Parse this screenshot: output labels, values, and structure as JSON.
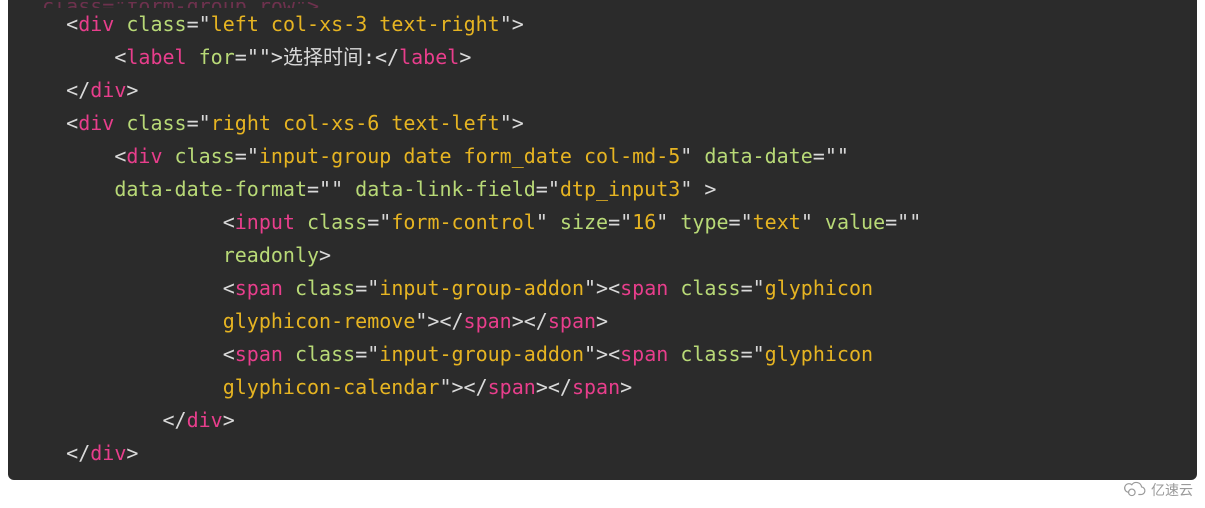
{
  "code": {
    "line0_frag": "  class=\"form-group row\">",
    "lines": [
      {
        "indent": 1,
        "parts": [
          {
            "c": "t-punct",
            "t": "<"
          },
          {
            "c": "t-tag",
            "t": "div"
          },
          {
            "c": "t-punct",
            "t": " "
          },
          {
            "c": "t-attr",
            "t": "class"
          },
          {
            "c": "t-op",
            "t": "="
          },
          {
            "c": "t-punct",
            "t": "\""
          },
          {
            "c": "t-str",
            "t": "left col-xs-3 text-right"
          },
          {
            "c": "t-punct",
            "t": "\""
          },
          {
            "c": "t-punct",
            "t": ">"
          }
        ]
      },
      {
        "indent": 2,
        "parts": [
          {
            "c": "t-punct",
            "t": "<"
          },
          {
            "c": "t-tag",
            "t": "label"
          },
          {
            "c": "t-punct",
            "t": " "
          },
          {
            "c": "t-attr",
            "t": "for"
          },
          {
            "c": "t-op",
            "t": "="
          },
          {
            "c": "t-punct",
            "t": "\""
          },
          {
            "c": "t-str",
            "t": ""
          },
          {
            "c": "t-punct",
            "t": "\""
          },
          {
            "c": "t-punct",
            "t": ">"
          },
          {
            "c": "t-text",
            "t": "选择时间:"
          },
          {
            "c": "t-punct",
            "t": "</"
          },
          {
            "c": "t-tag",
            "t": "label"
          },
          {
            "c": "t-punct",
            "t": ">"
          }
        ]
      },
      {
        "indent": 1,
        "parts": [
          {
            "c": "t-punct",
            "t": "</"
          },
          {
            "c": "t-tag",
            "t": "div"
          },
          {
            "c": "t-punct",
            "t": ">"
          }
        ]
      },
      {
        "indent": 1,
        "parts": [
          {
            "c": "t-punct",
            "t": "<"
          },
          {
            "c": "t-tag",
            "t": "div"
          },
          {
            "c": "t-punct",
            "t": " "
          },
          {
            "c": "t-attr",
            "t": "class"
          },
          {
            "c": "t-op",
            "t": "="
          },
          {
            "c": "t-punct",
            "t": "\""
          },
          {
            "c": "t-str",
            "t": "right col-xs-6 text-left"
          },
          {
            "c": "t-punct",
            "t": "\""
          },
          {
            "c": "t-punct",
            "t": ">"
          }
        ]
      },
      {
        "indent": 2,
        "parts": [
          {
            "c": "t-punct",
            "t": "<"
          },
          {
            "c": "t-tag",
            "t": "div"
          },
          {
            "c": "t-punct",
            "t": " "
          },
          {
            "c": "t-attr",
            "t": "class"
          },
          {
            "c": "t-op",
            "t": "="
          },
          {
            "c": "t-punct",
            "t": "\""
          },
          {
            "c": "t-str",
            "t": "input-group date form_date col-md-5"
          },
          {
            "c": "t-punct",
            "t": "\""
          },
          {
            "c": "t-punct",
            "t": " "
          },
          {
            "c": "t-attr",
            "t": "data-date"
          },
          {
            "c": "t-op",
            "t": "="
          },
          {
            "c": "t-punct",
            "t": "\""
          },
          {
            "c": "t-str",
            "t": ""
          },
          {
            "c": "t-punct",
            "t": "\""
          }
        ]
      },
      {
        "indent": 2,
        "parts": [
          {
            "c": "t-attr",
            "t": "data-date-format"
          },
          {
            "c": "t-op",
            "t": "="
          },
          {
            "c": "t-punct",
            "t": "\""
          },
          {
            "c": "t-str",
            "t": ""
          },
          {
            "c": "t-punct",
            "t": "\""
          },
          {
            "c": "t-punct",
            "t": " "
          },
          {
            "c": "t-attr",
            "t": "data-link-field"
          },
          {
            "c": "t-op",
            "t": "="
          },
          {
            "c": "t-punct",
            "t": "\""
          },
          {
            "c": "t-str",
            "t": "dtp_input3"
          },
          {
            "c": "t-punct",
            "t": "\""
          },
          {
            "c": "t-punct",
            "t": " >"
          }
        ]
      },
      {
        "indent": 4,
        "parts": [
          {
            "c": "t-punct",
            "t": "<"
          },
          {
            "c": "t-tag",
            "t": "input"
          },
          {
            "c": "t-punct",
            "t": " "
          },
          {
            "c": "t-attr",
            "t": "class"
          },
          {
            "c": "t-op",
            "t": "="
          },
          {
            "c": "t-punct",
            "t": "\""
          },
          {
            "c": "t-str",
            "t": "form-control"
          },
          {
            "c": "t-punct",
            "t": "\""
          },
          {
            "c": "t-punct",
            "t": " "
          },
          {
            "c": "t-attr",
            "t": "size"
          },
          {
            "c": "t-op",
            "t": "="
          },
          {
            "c": "t-punct",
            "t": "\""
          },
          {
            "c": "t-str",
            "t": "16"
          },
          {
            "c": "t-punct",
            "t": "\""
          },
          {
            "c": "t-punct",
            "t": " "
          },
          {
            "c": "t-attr",
            "t": "type"
          },
          {
            "c": "t-op",
            "t": "="
          },
          {
            "c": "t-punct",
            "t": "\""
          },
          {
            "c": "t-str",
            "t": "text"
          },
          {
            "c": "t-punct",
            "t": "\""
          },
          {
            "c": "t-punct",
            "t": " "
          },
          {
            "c": "t-attr",
            "t": "value"
          },
          {
            "c": "t-op",
            "t": "="
          },
          {
            "c": "t-punct",
            "t": "\""
          },
          {
            "c": "t-str",
            "t": ""
          },
          {
            "c": "t-punct",
            "t": "\""
          }
        ]
      },
      {
        "indent": 4,
        "parts": [
          {
            "c": "t-attr",
            "t": "readonly"
          },
          {
            "c": "t-punct",
            "t": ">"
          }
        ]
      },
      {
        "indent": 4,
        "parts": [
          {
            "c": "t-punct",
            "t": "<"
          },
          {
            "c": "t-tag",
            "t": "span"
          },
          {
            "c": "t-punct",
            "t": " "
          },
          {
            "c": "t-attr",
            "t": "class"
          },
          {
            "c": "t-op",
            "t": "="
          },
          {
            "c": "t-punct",
            "t": "\""
          },
          {
            "c": "t-str",
            "t": "input-group-addon"
          },
          {
            "c": "t-punct",
            "t": "\""
          },
          {
            "c": "t-punct",
            "t": ">"
          },
          {
            "c": "t-punct",
            "t": "<"
          },
          {
            "c": "t-tag",
            "t": "span"
          },
          {
            "c": "t-punct",
            "t": " "
          },
          {
            "c": "t-attr",
            "t": "class"
          },
          {
            "c": "t-op",
            "t": "="
          },
          {
            "c": "t-punct",
            "t": "\""
          },
          {
            "c": "t-str",
            "t": "glyphicon"
          }
        ]
      },
      {
        "indent": 4,
        "parts": [
          {
            "c": "t-str",
            "t": "glyphicon-remove"
          },
          {
            "c": "t-punct",
            "t": "\""
          },
          {
            "c": "t-punct",
            "t": ">"
          },
          {
            "c": "t-punct",
            "t": "</"
          },
          {
            "c": "t-tag",
            "t": "span"
          },
          {
            "c": "t-punct",
            "t": ">"
          },
          {
            "c": "t-punct",
            "t": "</"
          },
          {
            "c": "t-tag",
            "t": "span"
          },
          {
            "c": "t-punct",
            "t": ">"
          }
        ]
      },
      {
        "indent": 4,
        "parts": [
          {
            "c": "t-punct",
            "t": "<"
          },
          {
            "c": "t-tag",
            "t": "span"
          },
          {
            "c": "t-punct",
            "t": " "
          },
          {
            "c": "t-attr",
            "t": "class"
          },
          {
            "c": "t-op",
            "t": "="
          },
          {
            "c": "t-punct",
            "t": "\""
          },
          {
            "c": "t-str",
            "t": "input-group-addon"
          },
          {
            "c": "t-punct",
            "t": "\""
          },
          {
            "c": "t-punct",
            "t": ">"
          },
          {
            "c": "t-punct",
            "t": "<"
          },
          {
            "c": "t-tag",
            "t": "span"
          },
          {
            "c": "t-punct",
            "t": " "
          },
          {
            "c": "t-attr",
            "t": "class"
          },
          {
            "c": "t-op",
            "t": "="
          },
          {
            "c": "t-punct",
            "t": "\""
          },
          {
            "c": "t-str",
            "t": "glyphicon"
          }
        ]
      },
      {
        "indent": 4,
        "parts": [
          {
            "c": "t-str",
            "t": "glyphicon-calendar"
          },
          {
            "c": "t-punct",
            "t": "\""
          },
          {
            "c": "t-punct",
            "t": ">"
          },
          {
            "c": "t-punct",
            "t": "</"
          },
          {
            "c": "t-tag",
            "t": "span"
          },
          {
            "c": "t-punct",
            "t": ">"
          },
          {
            "c": "t-punct",
            "t": "</"
          },
          {
            "c": "t-tag",
            "t": "span"
          },
          {
            "c": "t-punct",
            "t": ">"
          }
        ]
      },
      {
        "indent": 3,
        "parts": [
          {
            "c": "t-punct",
            "t": "</"
          },
          {
            "c": "t-tag",
            "t": "div"
          },
          {
            "c": "t-punct",
            "t": ">"
          }
        ]
      },
      {
        "indent": 1,
        "parts": [
          {
            "c": "t-punct",
            "t": "</"
          },
          {
            "c": "t-tag",
            "t": "div"
          },
          {
            "c": "t-punct",
            "t": ">"
          }
        ]
      }
    ],
    "indent_unit": "    ",
    "special_indent_4": "                 "
  },
  "watermark": {
    "text": "亿速云"
  }
}
